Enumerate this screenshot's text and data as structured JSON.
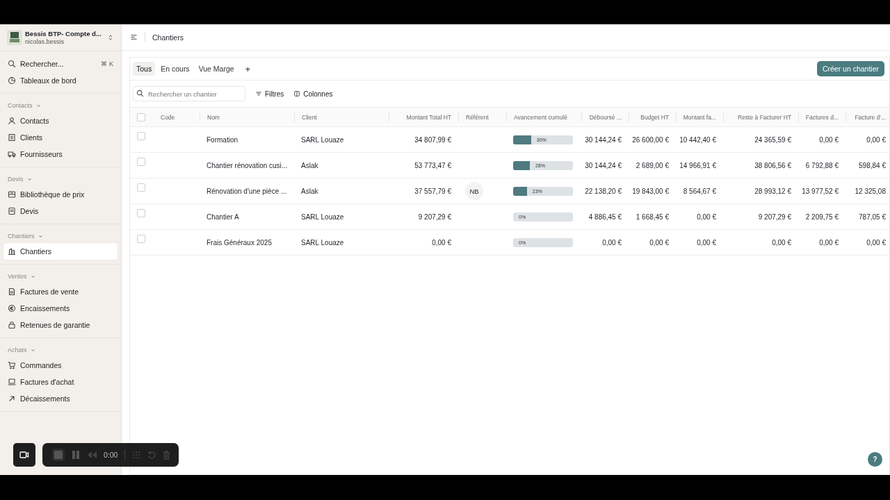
{
  "workspace": {
    "name": "Bessis BTP- Compte d...",
    "user": "nicolas.bessis"
  },
  "sidebar": {
    "top_items": [
      {
        "label": "Rechercher...",
        "shortcut": "⌘ K",
        "selected": false
      },
      {
        "label": "Tableaux de bord",
        "selected": false
      }
    ],
    "sections": [
      {
        "title": "Contacts",
        "expanded": true,
        "items": [
          {
            "label": "Contacts",
            "selected": false
          },
          {
            "label": "Clients",
            "selected": false
          },
          {
            "label": "Fournisseurs",
            "selected": false
          }
        ]
      },
      {
        "title": "Devis",
        "expanded": true,
        "items": [
          {
            "label": "Bibliothèque de prix",
            "selected": false
          },
          {
            "label": "Devis",
            "selected": false
          }
        ]
      },
      {
        "title": "Chantiers",
        "expanded": true,
        "items": [
          {
            "label": "Chantiers",
            "selected": true
          }
        ]
      },
      {
        "title": "Ventes",
        "expanded": true,
        "items": [
          {
            "label": "Factures de vente",
            "selected": false
          },
          {
            "label": "Encaissements",
            "selected": false
          },
          {
            "label": "Retenues de garantie",
            "selected": false
          }
        ]
      },
      {
        "title": "Achats",
        "expanded": true,
        "items": [
          {
            "label": "Commandes",
            "selected": false
          },
          {
            "label": "Factures d'achat",
            "selected": false
          },
          {
            "label": "Décaissements",
            "selected": false
          }
        ]
      }
    ]
  },
  "header": {
    "title": "Chantiers"
  },
  "tabs": [
    {
      "label": "Tous",
      "selected": true
    },
    {
      "label": "En cours",
      "selected": false
    },
    {
      "label": "Vue Marge",
      "selected": false
    }
  ],
  "add_tab": "+",
  "create_button": "Créer un chantier",
  "search": {
    "placeholder": "Rechercher un chantier"
  },
  "filters_button": "Filtres",
  "columns_button": "Colonnes",
  "table": {
    "select_all": {
      "checked": false
    },
    "columns": [
      {
        "label": "Code",
        "kind": "text"
      },
      {
        "label": "Nom",
        "kind": "text"
      },
      {
        "label": "Client",
        "kind": "text"
      },
      {
        "label": "Montant Total HT",
        "kind": "amount"
      },
      {
        "label": "Référent",
        "kind": "text"
      },
      {
        "label": "Avancement cumulé",
        "kind": "progress"
      },
      {
        "label": "Déboursé ...",
        "kind": "amount"
      },
      {
        "label": "Budget HT",
        "kind": "amount"
      },
      {
        "label": "Montant fa...",
        "kind": "amount"
      },
      {
        "label": "Reste à Facturer HT",
        "kind": "amount"
      },
      {
        "label": "Factures d...",
        "kind": "amount"
      },
      {
        "label": "Facture d'...",
        "kind": "amount"
      }
    ],
    "rows": [
      {
        "checked": false,
        "name": "Formation",
        "client": "SARL Louaze",
        "total": "34 807,99 €",
        "progress": {
          "level": 0.3,
          "label": "30%"
        },
        "amounts": [
          "30 144,24 €",
          "26 600,00 €",
          "10 442,40 €",
          "24 365,59 €",
          "0,00 €",
          "0,00 €"
        ]
      },
      {
        "checked": false,
        "name": "Chantier rénovation cusi...",
        "client": "Aslak",
        "total": "53 773,47 €",
        "progress": {
          "level": 0.28,
          "label": "28%"
        },
        "amounts": [
          "30 144,24 €",
          "2 689,00 €",
          "14 966,91 €",
          "38 806,56 €",
          "6 792,88 €",
          "598,84 €"
        ]
      },
      {
        "checked": false,
        "name": "Rénovation d'une pièce ...",
        "client": "Aslak",
        "total": "37 557,79 €",
        "referent": "NB",
        "progress": {
          "level": 0.23,
          "label": "23%"
        },
        "amounts": [
          "22 138,20 €",
          "19 843,00 €",
          "8 564,67 €",
          "28 993,12 €",
          "13 977,52 €",
          "12 325,08"
        ]
      },
      {
        "checked": false,
        "name": "Chantier A",
        "client": "SARL Louaze",
        "total": "9 207,29 €",
        "progress": {
          "level": 0,
          "label": "0%"
        },
        "amounts": [
          "4 886,45 €",
          "1 668,45 €",
          "0,00 €",
          "9 207,29 €",
          "2 209,75 €",
          "787,05 €"
        ]
      },
      {
        "checked": false,
        "name": "Frais Généraux 2025",
        "client": "SARL Louaze",
        "total": "0,00 €",
        "progress": {
          "level": 0,
          "label": "0%"
        },
        "amounts": [
          "0,00 €",
          "0,00 €",
          "0,00 €",
          "0,00 €",
          "0,00 €",
          "0,00 €"
        ]
      }
    ]
  },
  "recorder": {
    "time": "0:00"
  },
  "help_button": "?"
}
